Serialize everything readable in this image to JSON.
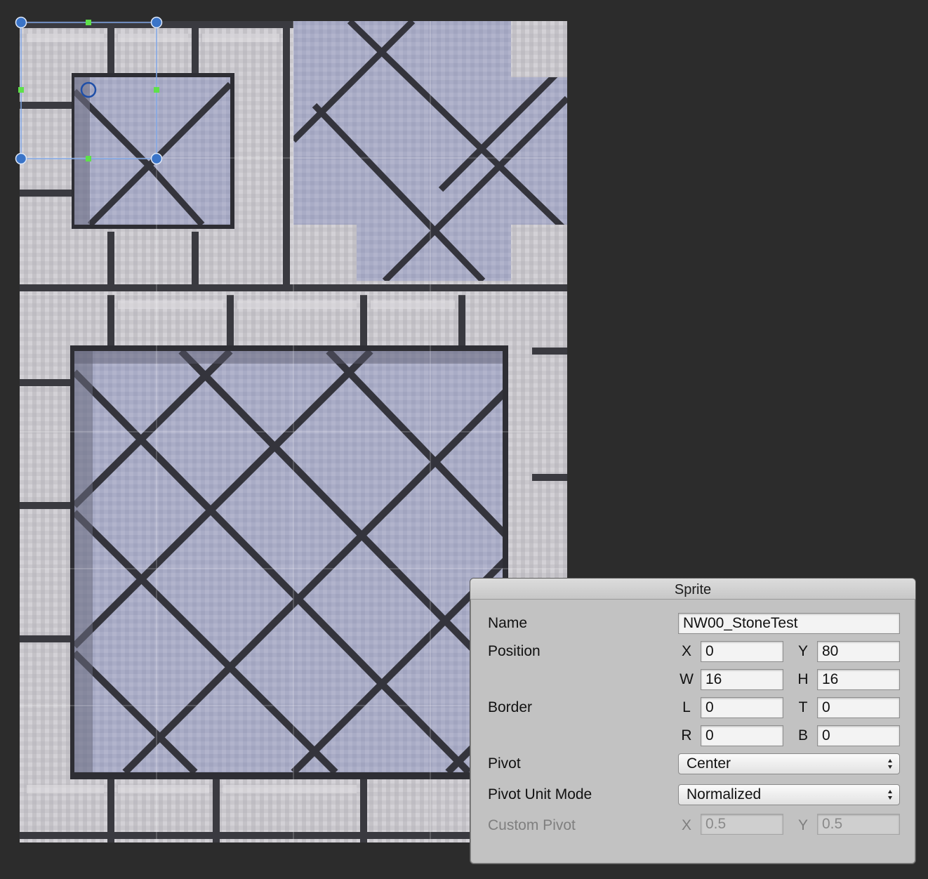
{
  "panel": {
    "title": "Sprite",
    "name_label": "Name",
    "name_value": "NW00_StoneTest",
    "position_label": "Position",
    "position": {
      "x_label": "X",
      "x_value": "0",
      "y_label": "Y",
      "y_value": "80",
      "w_label": "W",
      "w_value": "16",
      "h_label": "H",
      "h_value": "16"
    },
    "border_label": "Border",
    "border": {
      "l_label": "L",
      "l_value": "0",
      "t_label": "T",
      "t_value": "0",
      "r_label": "R",
      "r_value": "0",
      "b_label": "B",
      "b_value": "0"
    },
    "pivot_label": "Pivot",
    "pivot_value": "Center",
    "pivot_unit_mode_label": "Pivot Unit Mode",
    "pivot_unit_mode_value": "Normalized",
    "custom_pivot_label": "Custom Pivot",
    "custom_pivot": {
      "x_label": "X",
      "x_value": "0.5",
      "y_label": "Y",
      "y_value": "0.5"
    }
  },
  "colors": {
    "handle_blue": "#3a74c8",
    "handle_green": "#5ee04a",
    "selection_outline": "#7fa6e6"
  },
  "icons": {
    "dropdown_arrows": "updown-arrows-icon",
    "pivot_marker": "pivot-circle-icon"
  }
}
